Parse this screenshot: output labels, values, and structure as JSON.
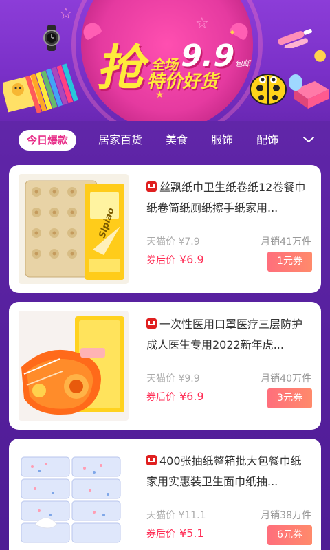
{
  "banner": {
    "big_char": "抢",
    "quanchang": "全场",
    "price": "9.9",
    "baoyou": "包邮",
    "tejia": "特价好货"
  },
  "tabs": [
    {
      "label": "今日爆款",
      "active": true
    },
    {
      "label": "居家百货",
      "active": false
    },
    {
      "label": "美食",
      "active": false
    },
    {
      "label": "服饰",
      "active": false
    },
    {
      "label": "配饰",
      "active": false
    }
  ],
  "icons": {
    "tab_more": "chevron-down-icon",
    "platform": "tmall-icon"
  },
  "colors": {
    "accent": "#ff2d55",
    "coupon_from": "#ff6f7c",
    "coupon_to": "#ff8a6b",
    "active_tab_text": "#e8308a",
    "background": "#5e24a6"
  },
  "products": [
    {
      "title": "丝飘纸巾卫生纸卷纸12卷餐巾纸卷筒纸厕纸擦手纸家用...",
      "tmall_price": "天猫价 ¥7.9",
      "sales": "月销41万件",
      "after_label": "券后价",
      "after_price": "¥6.9",
      "coupon": "1元券",
      "thumb": "toilet-paper-rolls",
      "package_text": "Sipiao"
    },
    {
      "title": "一次性医用口罩医疗三层防护成人医生专用2022新年虎...",
      "tmall_price": "天猫价 ¥9.9",
      "sales": "月销40万件",
      "after_label": "券后价",
      "after_price": "¥6.9",
      "coupon": "3元券",
      "thumb": "face-mask",
      "package_text": ""
    },
    {
      "title": "400张抽纸整箱批大包餐巾纸家用实惠装卫生面巾纸抽...",
      "tmall_price": "天猫价 ¥11.1",
      "sales": "月销38万件",
      "after_label": "券后价",
      "after_price": "¥5.1",
      "coupon": "6元券",
      "thumb": "tissue-packs",
      "package_text": ""
    }
  ]
}
